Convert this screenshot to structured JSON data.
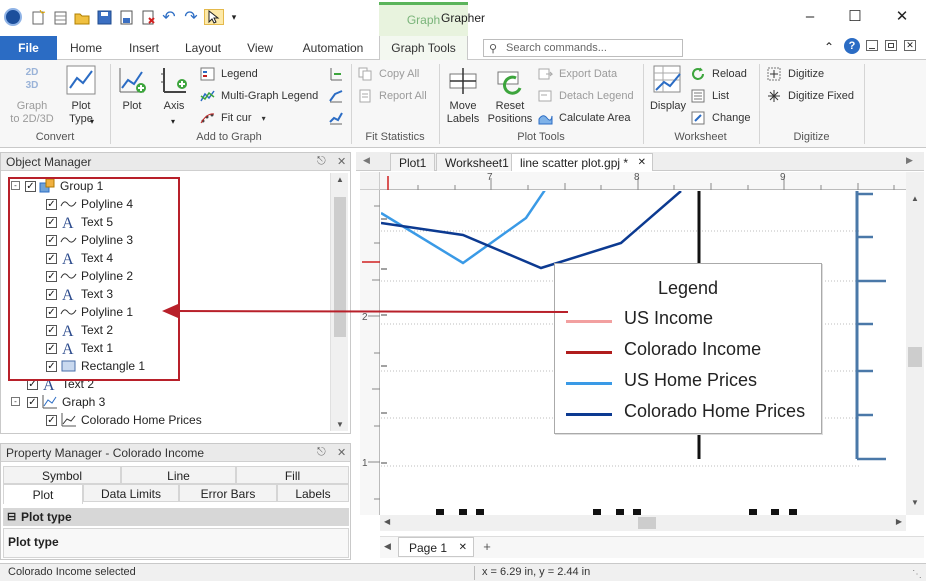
{
  "app": {
    "title": "Grapher",
    "context_tab_header": "Graph"
  },
  "ribbon_tabs": [
    "File",
    "Home",
    "Insert",
    "Layout",
    "View",
    "Automation",
    "Graph Tools"
  ],
  "search": {
    "placeholder": "Search commands..."
  },
  "ribbon": {
    "convert": {
      "label": "Convert",
      "graph_2d3d": "Graph\nto 2D/3D",
      "icon_text": "2D\n3D",
      "plot_type": "Plot\nType"
    },
    "add_to_graph": {
      "label": "Add to Graph",
      "plot": "Plot",
      "axis": "Axis",
      "legend": "Legend",
      "multi_graph_legend": "Multi-Graph Legend",
      "fit_curve": "Fit cur"
    },
    "fit_statistics": {
      "label": "Fit Statistics",
      "copy_all": "Copy All",
      "report_all": "Report All"
    },
    "plot_tools": {
      "label": "Plot Tools",
      "move_labels": "Move\nLabels",
      "reset_positions": "Reset\nPositions",
      "export_data": "Export Data",
      "detach_legend": "Detach Legend",
      "calculate_area": "Calculate Area"
    },
    "worksheet": {
      "label": "Worksheet",
      "display": "Display",
      "reload": "Reload",
      "list": "List",
      "change": "Change"
    },
    "digitize": {
      "label": "Digitize",
      "digitize": "Digitize",
      "digitize_fixed": "Digitize Fixed"
    }
  },
  "object_manager": {
    "title": "Object Manager",
    "items": [
      {
        "label": "Group 1",
        "kind": "group"
      },
      {
        "label": "Polyline 4",
        "kind": "polyline"
      },
      {
        "label": "Text 5",
        "kind": "text"
      },
      {
        "label": "Polyline 3",
        "kind": "polyline"
      },
      {
        "label": "Text 4",
        "kind": "text"
      },
      {
        "label": "Polyline 2",
        "kind": "polyline"
      },
      {
        "label": "Text 3",
        "kind": "text"
      },
      {
        "label": "Polyline 1",
        "kind": "polyline"
      },
      {
        "label": "Text 2",
        "kind": "text"
      },
      {
        "label": "Text 1",
        "kind": "text"
      },
      {
        "label": "Rectangle 1",
        "kind": "rectangle"
      },
      {
        "label": "Text 2",
        "kind": "text"
      },
      {
        "label": "Graph 3",
        "kind": "graph"
      },
      {
        "label": "Colorado Home Prices",
        "kind": "plot"
      }
    ]
  },
  "property_manager": {
    "title": "Property Manager - Colorado Income",
    "tabs_row1": [
      "Symbol",
      "Line",
      "Fill"
    ],
    "tabs_row2": [
      "Plot",
      "Data Limits",
      "Error Bars",
      "Labels"
    ],
    "section": "Plot type",
    "field": "Plot type"
  },
  "doc_tabs": [
    "Plot1",
    "Worksheet1",
    "line scatter plot.gpj *"
  ],
  "ruler": {
    "top_marks": [
      "7",
      "8",
      "9"
    ],
    "left_marks": [
      "2",
      "1"
    ]
  },
  "legend": {
    "title": "Legend",
    "entries": [
      {
        "label": "US Income",
        "color": "#f2a0a0"
      },
      {
        "label": "Colorado Income",
        "color": "#b01c1c"
      },
      {
        "label": "US Home Prices",
        "color": "#3a9ae6"
      },
      {
        "label": "Colorado Home Prices",
        "color": "#0c3a91"
      }
    ]
  },
  "page_tabs": [
    "Page 1"
  ],
  "status": {
    "selection": "Colorado Income selected",
    "coords": "x = 6.29 in, y = 2.44 in"
  },
  "colors": {
    "file_tab": "#2b6cc4",
    "highlight": "#b8202a",
    "axis_blue": "#4a78a8"
  }
}
